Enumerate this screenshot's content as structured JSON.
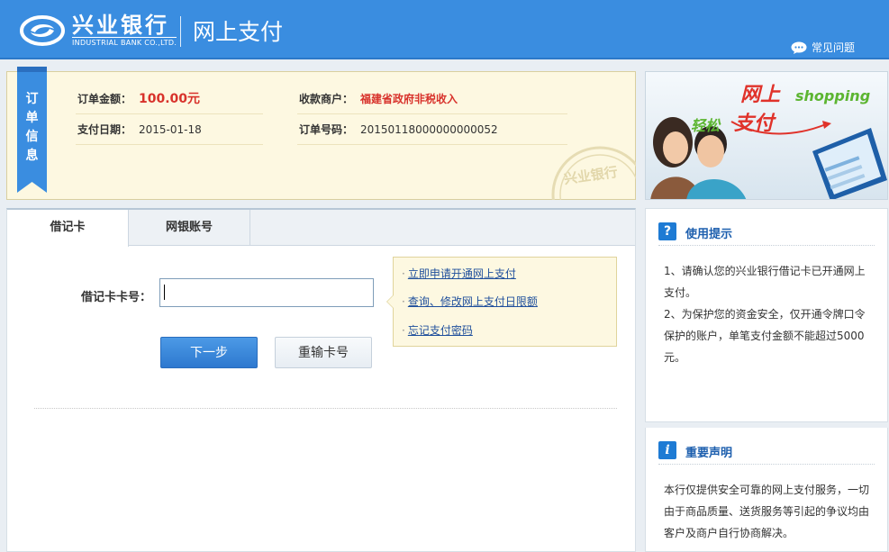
{
  "header": {
    "logo_cn": "兴业银行",
    "logo_en": "INDUSTRIAL BANK CO.,LTD.",
    "title": "网上支付",
    "faq": "常见问题",
    "colors": {
      "header_bg": "#3a8de0",
      "accent_blue": "#2d78cf",
      "red": "#d8322b"
    }
  },
  "order": {
    "ribbon": [
      "订",
      "单",
      "信",
      "息"
    ],
    "amount_label": "订单金额：",
    "amount_value": "100.00元",
    "merchant_label": "收款商户：",
    "merchant_value": "福建省政府非税收入",
    "date_label": "支付日期：",
    "date_value": "2015-01-18",
    "order_no_label": "订单号码：",
    "order_no_value": "20150118000000000052",
    "stamp_text": "兴业银行"
  },
  "promo": {
    "line1": "网上",
    "line1_en": "shopping",
    "line2a": "轻松",
    "line2b": "支付"
  },
  "tabs": [
    {
      "label": "借记卡",
      "active": true
    },
    {
      "label": "网银账号",
      "active": false
    }
  ],
  "form": {
    "card_label": "借记卡卡号：",
    "card_value": "",
    "card_placeholder": "",
    "next_button": "下一步",
    "reset_button": "重输卡号"
  },
  "help_links": [
    "立即申请开通网上支付",
    "查询、修改网上支付日限额",
    "忘记支付密码"
  ],
  "tips": {
    "icon": "?",
    "title": "使用提示",
    "body": "1、请确认您的兴业银行借记卡已开通网上支付。\n2、为保护您的资金安全，仅开通令牌口令保护的账户，单笔支付金额不能超过5000元。"
  },
  "notice": {
    "icon": "i",
    "title": "重要声明",
    "body": "本行仅提供安全可靠的网上支付服务，一切由于商品质量、送货服务等引起的争议均由客户及商户自行协商解决。"
  }
}
